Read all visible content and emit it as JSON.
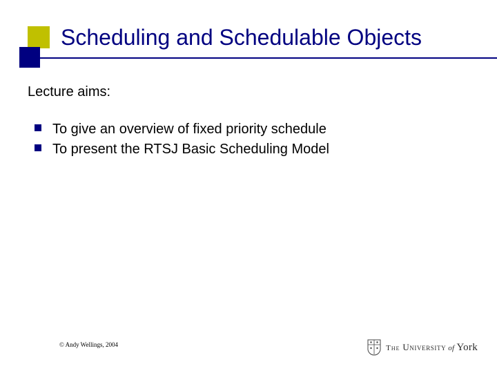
{
  "slide": {
    "title": "Scheduling and Schedulable Objects",
    "lead": "Lecture aims:",
    "bullets": [
      "To give an overview of fixed priority schedule",
      "To present the  RTSJ Basic Scheduling Model"
    ]
  },
  "footer": {
    "copyright": "© Andy Wellings, 2004",
    "logo_the": "The ",
    "logo_univ": "University",
    "logo_of": " of ",
    "logo_york": "York"
  },
  "colors": {
    "accent_navy": "#000080",
    "accent_olive": "#c0c000"
  }
}
